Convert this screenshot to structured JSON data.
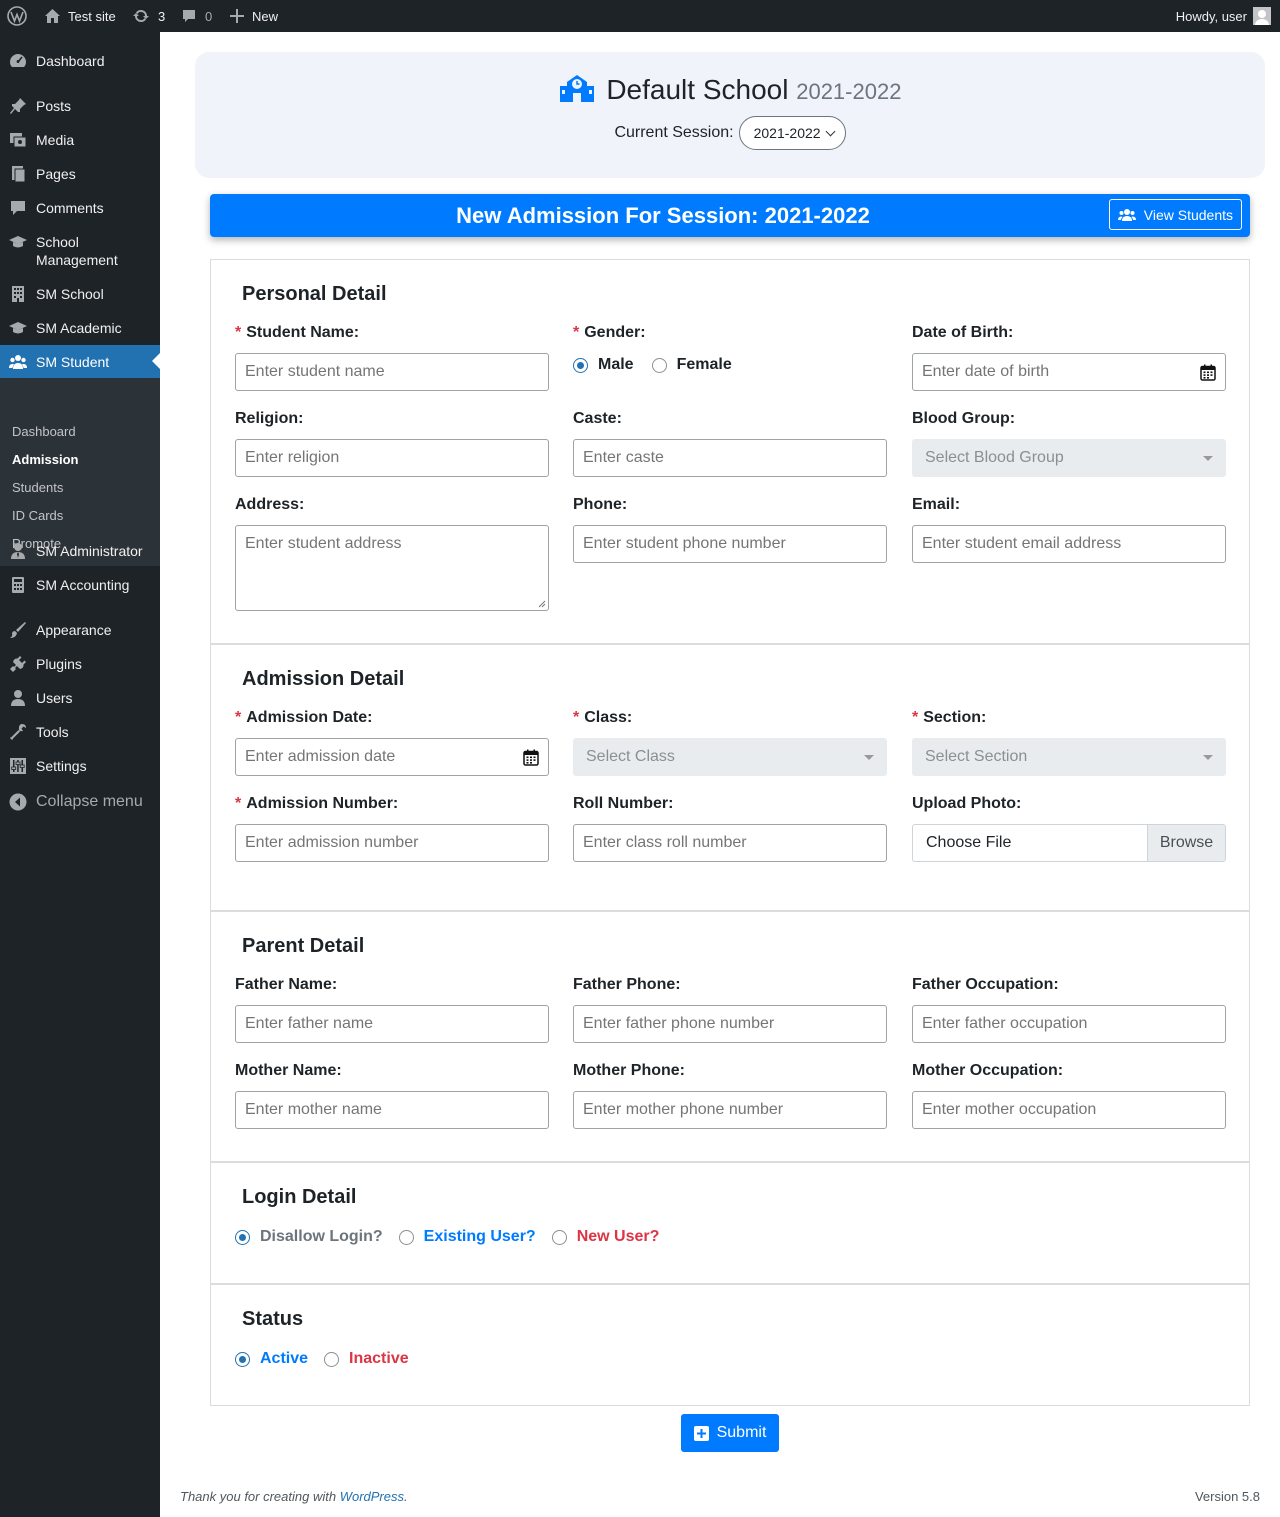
{
  "admin_bar": {
    "site_name": "Test site",
    "updates_count": "3",
    "comments_count": "0",
    "new_label": "New",
    "howdy": "Howdy, user"
  },
  "menu": {
    "items": [
      {
        "label": "Dashboard"
      },
      {
        "label": "Posts"
      },
      {
        "label": "Media"
      },
      {
        "label": "Pages"
      },
      {
        "label": "Comments"
      },
      {
        "label": "School Management"
      },
      {
        "label": "SM School"
      },
      {
        "label": "SM Academic"
      },
      {
        "label": "SM Student"
      },
      {
        "label": "SM Administrator"
      },
      {
        "label": "SM Accounting"
      },
      {
        "label": "Appearance"
      },
      {
        "label": "Plugins"
      },
      {
        "label": "Users"
      },
      {
        "label": "Tools"
      },
      {
        "label": "Settings"
      },
      {
        "label": "Collapse menu"
      }
    ],
    "submenu": [
      {
        "label": "Dashboard"
      },
      {
        "label": "Admission"
      },
      {
        "label": "Students"
      },
      {
        "label": "ID Cards"
      },
      {
        "label": "Promote"
      }
    ]
  },
  "header": {
    "school_name": "Default School",
    "session_year": "2021-2022",
    "current_session_label": "Current Session:",
    "current_session_value": "2021-2022",
    "brand_color": "#007bff"
  },
  "banner": {
    "title": "New Admission For Session: 2021-2022",
    "view_students": "View Students"
  },
  "personal": {
    "title": "Personal Detail",
    "student_name_label": "Student Name:",
    "student_name_placeholder": "Enter student name",
    "gender_label": "Gender:",
    "gender_male": "Male",
    "gender_female": "Female",
    "dob_label": "Date of Birth:",
    "dob_placeholder": "Enter date of birth",
    "religion_label": "Religion:",
    "religion_placeholder": "Enter religion",
    "caste_label": "Caste:",
    "caste_placeholder": "Enter caste",
    "blood_label": "Blood Group:",
    "blood_placeholder": "Select Blood Group",
    "address_label": "Address:",
    "address_placeholder": "Enter student address",
    "phone_label": "Phone:",
    "phone_placeholder": "Enter student phone number",
    "email_label": "Email:",
    "email_placeholder": "Enter student email address"
  },
  "admission": {
    "title": "Admission Detail",
    "date_label": "Admission Date:",
    "date_placeholder": "Enter admission date",
    "class_label": "Class:",
    "class_placeholder": "Select Class",
    "section_label": "Section:",
    "section_placeholder": "Select Section",
    "number_label": "Admission Number:",
    "number_placeholder": "Enter admission number",
    "roll_label": "Roll Number:",
    "roll_placeholder": "Enter class roll number",
    "photo_label": "Upload Photo:",
    "photo_choose": "Choose File",
    "photo_browse": "Browse"
  },
  "parent": {
    "title": "Parent Detail",
    "father_name_label": "Father Name:",
    "father_name_placeholder": "Enter father name",
    "father_phone_label": "Father Phone:",
    "father_phone_placeholder": "Enter father phone number",
    "father_occ_label": "Father Occupation:",
    "father_occ_placeholder": "Enter father occupation",
    "mother_name_label": "Mother Name:",
    "mother_name_placeholder": "Enter mother name",
    "mother_phone_label": "Mother Phone:",
    "mother_phone_placeholder": "Enter mother phone number",
    "mother_occ_label": "Mother Occupation:",
    "mother_occ_placeholder": "Enter mother occupation"
  },
  "login": {
    "title": "Login Detail",
    "disallow": "Disallow Login?",
    "existing": "Existing User?",
    "new_user": "New User?"
  },
  "status": {
    "title": "Status",
    "active": "Active",
    "inactive": "Inactive"
  },
  "submit_label": "Submit",
  "footer": {
    "thanks": "Thank you for creating with",
    "wp_link": "WordPress",
    "period": ".",
    "version": "Version 5.8"
  }
}
